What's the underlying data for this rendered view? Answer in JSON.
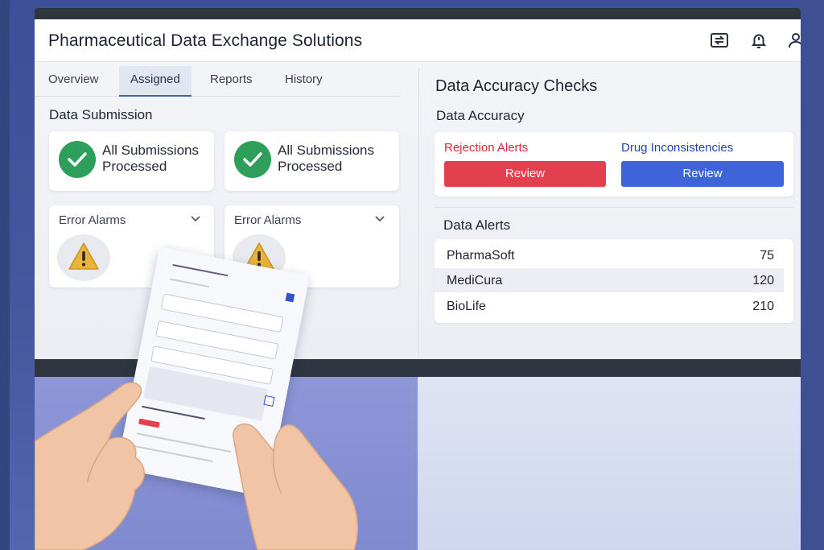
{
  "app": {
    "title": "Pharmaceutical Data Exchange Solutions"
  },
  "header_icons": [
    "exchange-icon",
    "bell-icon",
    "user-icon"
  ],
  "tabs": [
    {
      "label": "Overview",
      "active": false
    },
    {
      "label": "Assigned",
      "active": true
    },
    {
      "label": "Reports",
      "active": false
    },
    {
      "label": "History",
      "active": false
    }
  ],
  "data_submission": {
    "title": "Data Submission",
    "cards": [
      {
        "line1": "All Submissions",
        "line2": "Processed",
        "icon": "check-icon"
      },
      {
        "line1": "All Submissions",
        "line2": "Processed",
        "icon": "check-icon"
      }
    ],
    "alarms": [
      {
        "label": "Error Alarms",
        "icon": "warning-icon"
      },
      {
        "label": "Error Alarms",
        "icon": "warning-icon"
      }
    ]
  },
  "accuracy": {
    "panel_title": "Data Accuracy Checks",
    "subtitle": "Data Accuracy",
    "rejection_label": "Rejection Alerts",
    "drug_label": "Drug Inconsistencies",
    "review_label": "Review",
    "colors": {
      "rejection": "#d6283a",
      "drug": "#2445a8",
      "review_red": "#e2404f",
      "review_blue": "#3f63d8"
    }
  },
  "data_alerts": {
    "title": "Data Alerts",
    "rows": [
      {
        "name": "PharmaSoft",
        "value": "75"
      },
      {
        "name": "MediCura",
        "value": "120"
      },
      {
        "name": "BioLife",
        "value": "210"
      }
    ]
  },
  "colors": {
    "success": "#2e9e5b",
    "warning": "#e8b43a",
    "accent": "#4a5fae"
  }
}
